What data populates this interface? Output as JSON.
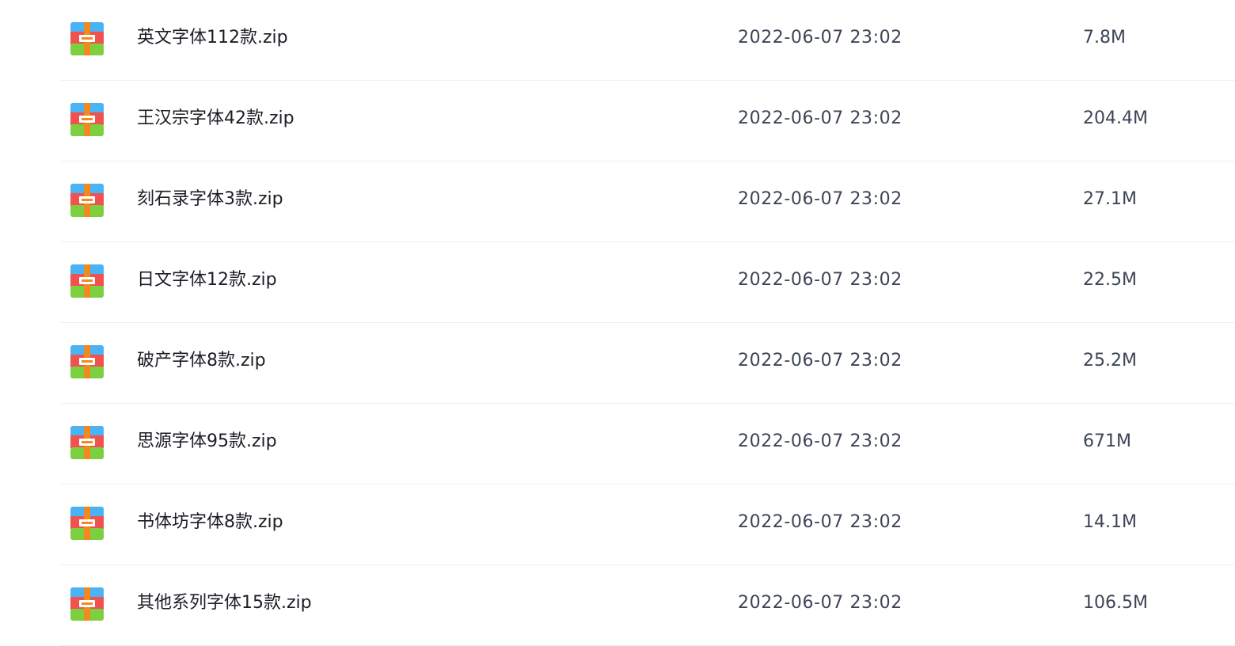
{
  "icon": "zip-archive-icon",
  "colors": {
    "icon_top": "#4ab3f4",
    "icon_middle": "#f0524f",
    "icon_bottom": "#7ccf3f",
    "icon_strap": "#f2891f",
    "text_primary": "#1b1e24",
    "text_secondary": "#3c4556",
    "row_divider": "#eef0f3"
  },
  "files": [
    {
      "name": "英文字体112款.zip",
      "date": "2022-06-07 23:02",
      "size": "7.8M"
    },
    {
      "name": "王汉宗字体42款.zip",
      "date": "2022-06-07 23:02",
      "size": "204.4M"
    },
    {
      "name": "刻石录字体3款.zip",
      "date": "2022-06-07 23:02",
      "size": "27.1M"
    },
    {
      "name": "日文字体12款.zip",
      "date": "2022-06-07 23:02",
      "size": "22.5M"
    },
    {
      "name": "破产字体8款.zip",
      "date": "2022-06-07 23:02",
      "size": "25.2M"
    },
    {
      "name": "思源字体95款.zip",
      "date": "2022-06-07 23:02",
      "size": "671M"
    },
    {
      "name": "书体坊字体8款.zip",
      "date": "2022-06-07 23:02",
      "size": "14.1M"
    },
    {
      "name": "其他系列字体15款.zip",
      "date": "2022-06-07 23:02",
      "size": "106.5M"
    }
  ]
}
